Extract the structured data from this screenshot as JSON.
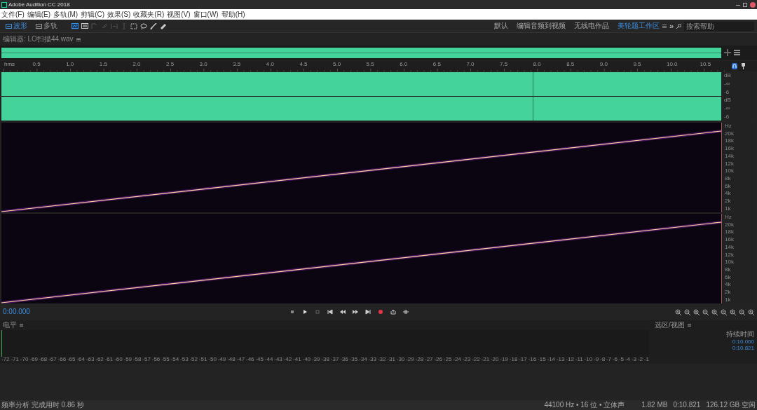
{
  "window": {
    "title": "Adobe Audition CC 2018"
  },
  "menu": [
    "文件(F)",
    "编辑(E)",
    "多轨(M)",
    "剪辑(C)",
    "效果(S)",
    "收藏夹(R)",
    "视图(V)",
    "窗口(W)",
    "帮助(H)"
  ],
  "views": [
    {
      "label": "波形",
      "selected": true
    },
    {
      "label": "多轨",
      "selected": false
    }
  ],
  "tools": [
    {
      "kind": "spectral",
      "selected": true
    },
    {
      "kind": "pitch",
      "selected": false
    },
    {
      "kind": "move",
      "selected": false,
      "disabled": true
    },
    {
      "kind": "razor",
      "selected": false,
      "disabled": true
    },
    {
      "kind": "slip",
      "selected": false,
      "disabled": true
    },
    {
      "kind": "time",
      "selected": false,
      "disabled": true
    },
    {
      "kind": "marquee",
      "selected": false,
      "disabled": false
    },
    {
      "kind": "lasso",
      "selected": false,
      "disabled": false
    },
    {
      "kind": "brush",
      "selected": false,
      "disabled": false
    },
    {
      "kind": "heal",
      "selected": false,
      "disabled": false
    }
  ],
  "workspaces": [
    {
      "label": "默认",
      "selected": false
    },
    {
      "label": "编辑音频到视频",
      "selected": false
    },
    {
      "label": "无线电作品",
      "selected": false
    },
    {
      "label": "美轮题工作区",
      "selected": true
    }
  ],
  "more": "»",
  "search": {
    "placeholder": "搜索帮助"
  },
  "editor": {
    "title": "编辑器: LO扫描44.wav"
  },
  "ruler": [
    "hms",
    "0.5",
    "1.0",
    "1.5",
    "2.0",
    "2.5",
    "3.0",
    "3.5",
    "4.0",
    "4.5",
    "5.0",
    "5.5",
    "6.0",
    "6.5",
    "7.0",
    "7.5",
    "8.0",
    "8.5",
    "9.0",
    "9.5",
    "10.0",
    "10.5"
  ],
  "channels": [
    {
      "scale": [
        "dB",
        "-∞",
        "-6"
      ]
    },
    {
      "scale": [
        "dB",
        "-∞",
        "-6"
      ]
    }
  ],
  "spectral": [
    {
      "scale": [
        "Hz",
        "20k",
        "18k",
        "16k",
        "14k",
        "12k",
        "10k",
        "8k",
        "6k",
        "4k",
        "2k",
        "1k"
      ]
    },
    {
      "scale": [
        "Hz",
        "20k",
        "18k",
        "16k",
        "14k",
        "12k",
        "10k",
        "8k",
        "6k",
        "4k",
        "2k",
        "1k"
      ]
    }
  ],
  "transport": {
    "time": "0:00.000",
    "buttons": [
      {
        "kind": "stop"
      },
      {
        "kind": "play"
      },
      {
        "kind": "pause"
      },
      {
        "kind": "start"
      },
      {
        "kind": "rewind"
      },
      {
        "kind": "forward"
      },
      {
        "kind": "end"
      },
      {
        "kind": "record"
      },
      {
        "kind": "loop"
      },
      {
        "kind": "skip"
      }
    ]
  },
  "level": {
    "title": "电平",
    "scale": [
      "-72",
      "-71",
      "-70",
      "-69",
      "-68",
      "-67",
      "-66",
      "-65",
      "-64",
      "-63",
      "-62",
      "-61",
      "-60",
      "-59",
      "-58",
      "-57",
      "-56",
      "-55",
      "-54",
      "-53",
      "-52",
      "-51",
      "-50",
      "-49",
      "-48",
      "-47",
      "-46",
      "-45",
      "-44",
      "-43",
      "-42",
      "-41",
      "-40",
      "-39",
      "-38",
      "-37",
      "-36",
      "-35",
      "-34",
      "-33",
      "-32",
      "-31",
      "-30",
      "-29",
      "-28",
      "-27",
      "-26",
      "-25",
      "-24",
      "-23",
      "-22",
      "-21",
      "-20",
      "-19",
      "-18",
      "-17",
      "-16",
      "-15",
      "-14",
      "-13",
      "-12",
      "-11",
      "-10",
      "-9",
      "-8",
      "-7",
      "-6",
      "-5",
      "-4",
      "-3",
      "-2",
      "-1"
    ]
  },
  "selection": {
    "title": "选区/视图",
    "heading": "持续时间",
    "values": [
      "0:10.000",
      "0:10.821"
    ]
  },
  "status": {
    "message": "频率分析 完成用时 0.86 秒",
    "format": "44100 Hz • 16 位 • 立体声",
    "size": "1.82 MB",
    "duration": "0:10.821",
    "free": "126.12 GB 空闲"
  }
}
